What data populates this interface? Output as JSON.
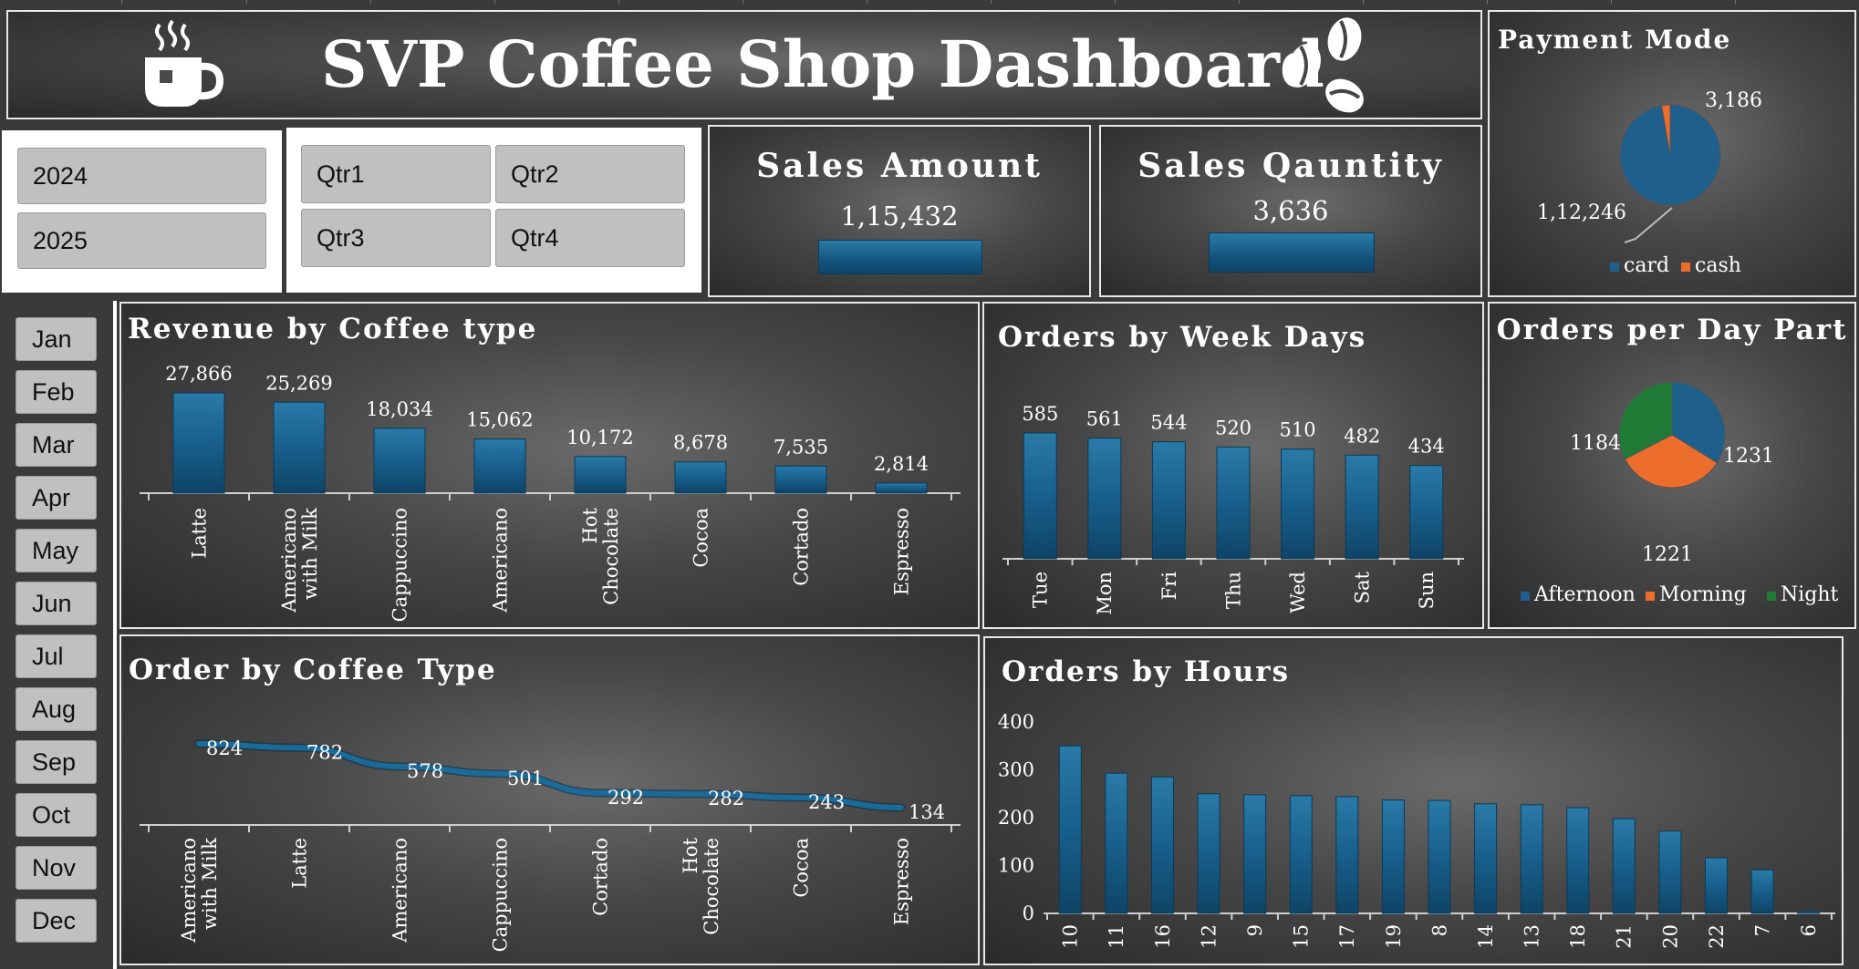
{
  "header": {
    "title": "SVP Coffee Shop Dashboard"
  },
  "year_slicer": {
    "items": [
      "2024",
      "2025"
    ]
  },
  "quarter_slicer": {
    "items": [
      "Qtr1",
      "Qtr2",
      "Qtr3",
      "Qtr4"
    ]
  },
  "month_slicer": {
    "items": [
      "Jan",
      "Feb",
      "Mar",
      "Apr",
      "May",
      "Jun",
      "Jul",
      "Aug",
      "Sep",
      "Oct",
      "Nov",
      "Dec"
    ]
  },
  "kpis": {
    "sales_amount": {
      "title": "Sales Amount",
      "value": "1,15,432"
    },
    "sales_quantity": {
      "title": "Sales Qauntity",
      "value": "3,636"
    }
  },
  "colors": {
    "bar": "#14557e",
    "card": "#1f5f8b",
    "cash": "#ed6d2c",
    "afternoon": "#1f5f8b",
    "morning": "#ed6d2c",
    "night": "#1e7a34"
  },
  "chart_data": [
    {
      "type": "pie",
      "title": "Payment Mode",
      "categories": [
        "card",
        "cash"
      ],
      "values": [
        112246,
        3186
      ],
      "labels": [
        "1,12,246",
        "3,186"
      ],
      "legend": "bottom"
    },
    {
      "type": "bar",
      "title": "Revenue by Coffee type",
      "categories": [
        "Latte",
        "Americano with Milk",
        "Cappuccino",
        "Americano",
        "Hot Chocolate",
        "Cocoa",
        "Cortado",
        "Espresso"
      ],
      "category_lines": [
        [
          "Latte"
        ],
        [
          "Americano",
          "with Milk"
        ],
        [
          "Cappuccino"
        ],
        [
          "Americano"
        ],
        [
          "Hot",
          "Chocolate"
        ],
        [
          "Cocoa"
        ],
        [
          "Cortado"
        ],
        [
          "Espresso"
        ]
      ],
      "values": [
        27866,
        25269,
        18034,
        15062,
        10172,
        8678,
        7535,
        2814
      ],
      "labels": [
        "27,866",
        "25,269",
        "18,034",
        "15,062",
        "10,172",
        "8,678",
        "7,535",
        "2,814"
      ]
    },
    {
      "type": "bar",
      "title": "Orders by Week Days",
      "categories": [
        "Tue",
        "Mon",
        "Fri",
        "Thu",
        "Wed",
        "Sat",
        "Sun"
      ],
      "values": [
        585,
        561,
        544,
        520,
        510,
        482,
        434
      ]
    },
    {
      "type": "pie",
      "title": "Orders per Day Part",
      "categories": [
        "Afternoon",
        "Morning",
        "Night"
      ],
      "values": [
        1231,
        1221,
        1184
      ],
      "legend": "bottom"
    },
    {
      "type": "line",
      "title": "Order by Coffee Type",
      "categories": [
        "Americano with Milk",
        "Latte",
        "Americano",
        "Cappuccino",
        "Cortado",
        "Hot Chocolate",
        "Cocoa",
        "Espresso"
      ],
      "category_lines": [
        [
          "Americano",
          "with Milk"
        ],
        [
          "Latte"
        ],
        [
          "Americano"
        ],
        [
          "Cappuccino"
        ],
        [
          "Cortado"
        ],
        [
          "Hot",
          "Chocolate"
        ],
        [
          "Cocoa"
        ],
        [
          "Espresso"
        ]
      ],
      "values": [
        824,
        782,
        578,
        501,
        292,
        282,
        243,
        134
      ]
    },
    {
      "type": "bar",
      "title": "Orders by Hours",
      "categories": [
        "10",
        "11",
        "16",
        "12",
        "9",
        "15",
        "17",
        "19",
        "8",
        "14",
        "13",
        "18",
        "21",
        "20",
        "22",
        "7",
        "6"
      ],
      "values": [
        350,
        293,
        285,
        250,
        248,
        246,
        244,
        237,
        236,
        229,
        227,
        221,
        198,
        172,
        116,
        91,
        4
      ],
      "ylim": [
        0,
        400
      ],
      "yticks": [
        "0",
        "100",
        "200",
        "300",
        "400"
      ]
    }
  ]
}
